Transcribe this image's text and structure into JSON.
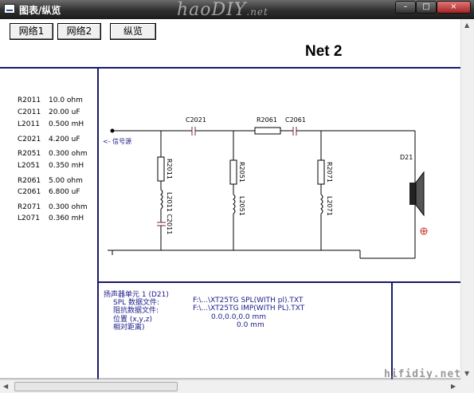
{
  "window": {
    "title": "图表/纵览",
    "logo": "haoDIY",
    "logo_suffix": ".net",
    "controls": {
      "minimize": "–",
      "maximize": "□",
      "close": "×"
    }
  },
  "toolbar": {
    "buttons": [
      {
        "label": "网络1"
      },
      {
        "label": "网络2"
      },
      {
        "label": "纵览"
      }
    ],
    "net_title": "Net 2"
  },
  "components": [
    {
      "name": "R2011",
      "value": "10.0 ohm"
    },
    {
      "name": "C2011",
      "value": "20.00 uF"
    },
    {
      "name": "L2011",
      "value": "0.500 mH"
    },
    {
      "name": "C2021",
      "value": "4.200 uF"
    },
    {
      "name": "R2051",
      "value": "0.300 ohm"
    },
    {
      "name": "L2051",
      "value": "0.350 mH"
    },
    {
      "name": "R2061",
      "value": "5.00 ohm"
    },
    {
      "name": "C2061",
      "value": "6.800 uF"
    },
    {
      "name": "R2071",
      "value": "0.300 ohm"
    },
    {
      "name": "L2071",
      "value": "0.360 mH"
    }
  ],
  "schematic": {
    "source_label": "<- 信号源",
    "labels": {
      "c2021": "C2021",
      "r2061": "R2061",
      "c2061": "C2061",
      "d21": "D21",
      "r2011": "R2011",
      "l2011_c2011": "L2011 C2011",
      "r2051": "R2051",
      "l2051": "L2051",
      "r2071": "R2071",
      "l2071": "L2071"
    }
  },
  "driver_info": {
    "header": "扬声器单元 1 (D21)",
    "rows": [
      {
        "label": "SPL 数据文件:",
        "value": "F:\\...\\XT25TG SPL(WITH pl).TXT"
      },
      {
        "label": "阻抗数据文件:",
        "value": "F:\\...\\XT25TG IMP(WITH PL).TXT"
      },
      {
        "label": "位置 (x,y,z)",
        "value": "0.0,0.0,0.0 mm"
      },
      {
        "label": "相对距离)",
        "value": "0.0 mm"
      }
    ]
  },
  "watermark": "hifidiy.net"
}
